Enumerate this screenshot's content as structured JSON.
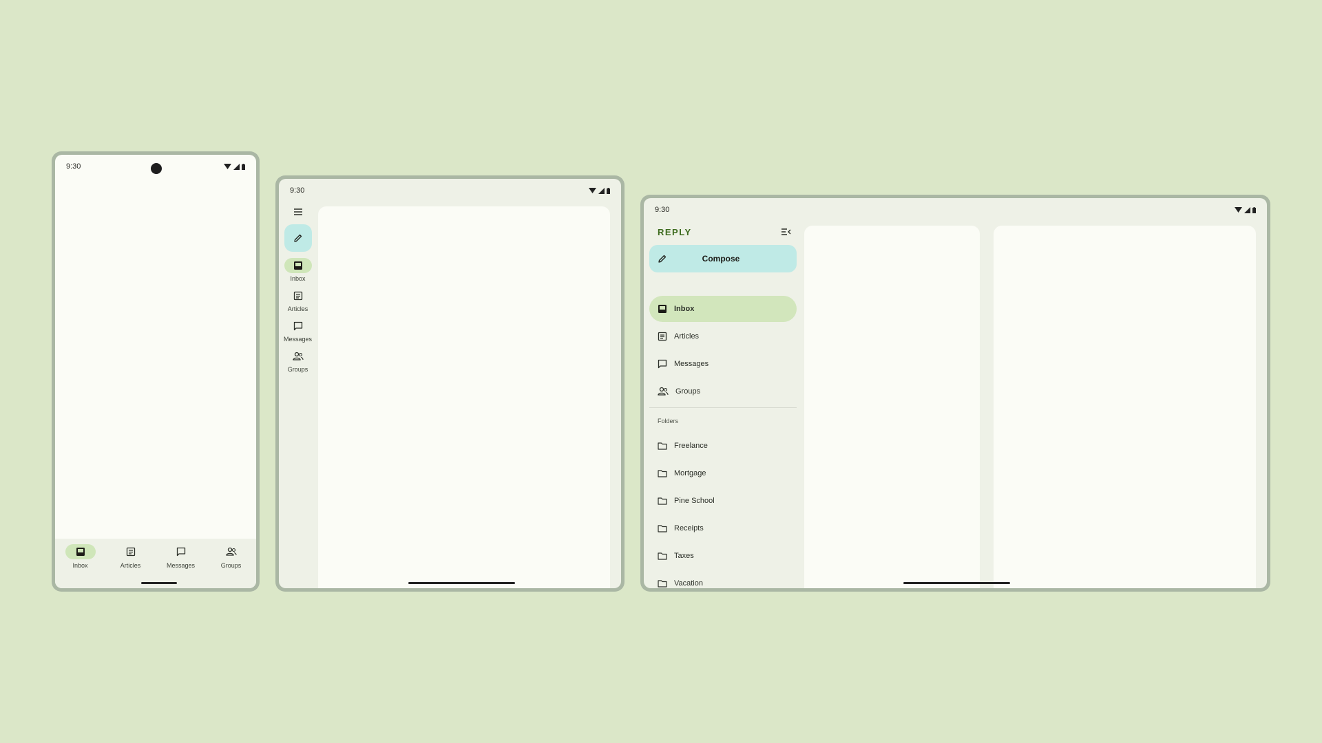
{
  "status_bar": {
    "time": "9:30"
  },
  "nav": {
    "items": [
      {
        "label": "Inbox",
        "icon": "inbox-icon",
        "active": true
      },
      {
        "label": "Articles",
        "icon": "article-icon",
        "active": false
      },
      {
        "label": "Messages",
        "icon": "chat-icon",
        "active": false
      },
      {
        "label": "Groups",
        "icon": "groups-icon",
        "active": false
      }
    ]
  },
  "drawer": {
    "brand": "REPLY",
    "compose_label": "Compose",
    "folders_label": "Folders",
    "folders": [
      "Freelance",
      "Mortgage",
      "Pine School",
      "Receipts",
      "Taxes",
      "Vacation"
    ]
  },
  "colors": {
    "background": "#dbe7c8",
    "accent_active": "#cfe6b9",
    "compose_fab": "#bfeae6",
    "brand_text": "#3d6b1e",
    "surface": "#fbfcf6",
    "frame": "#aab7a4"
  }
}
